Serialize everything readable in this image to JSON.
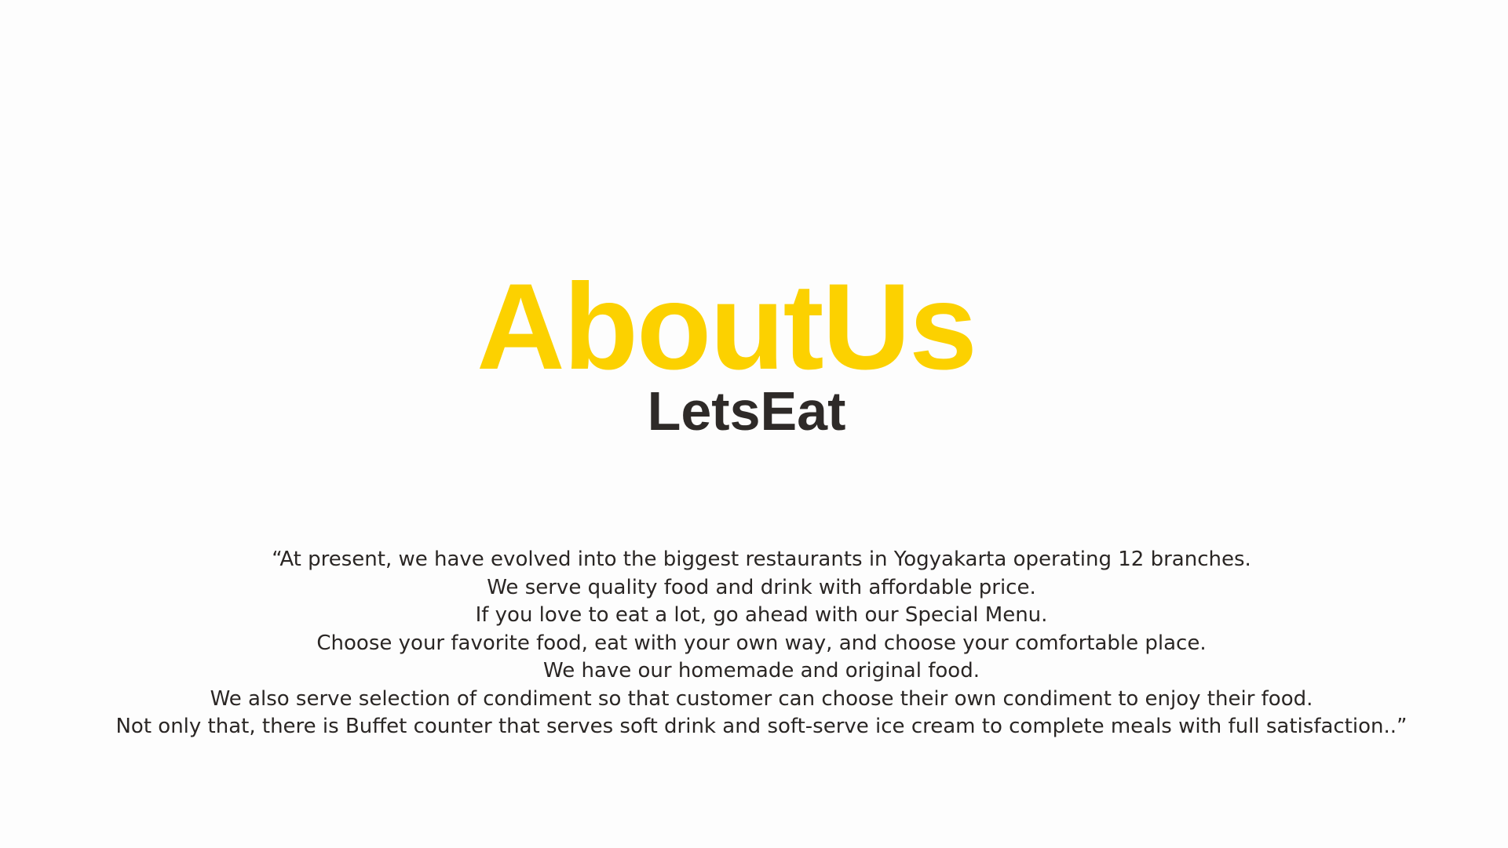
{
  "page": {
    "title": "AboutUs",
    "subtitle": "LetsEat",
    "quote_lines": [
      "“At present, we have evolved into the biggest restaurants in Yogyakarta operating 12 branches.",
      "We serve quality food and drink with affordable price.",
      "If you love to eat a lot, go ahead with our Special Menu.",
      "Choose your favorite food, eat with your own way, and choose your comfortable place.",
      "We have our homemade and original food.",
      "We also serve selection of condiment so that customer can choose their own condiment to enjoy their food.",
      "Not only that, there is Buffet counter that serves soft drink and soft-serve ice cream to complete meals with full satisfaction..”"
    ]
  },
  "colors": {
    "background": "#fdfdfd",
    "title": "#fcd100",
    "subtitle": "#2e2a28",
    "body_text": "#2a2624"
  }
}
